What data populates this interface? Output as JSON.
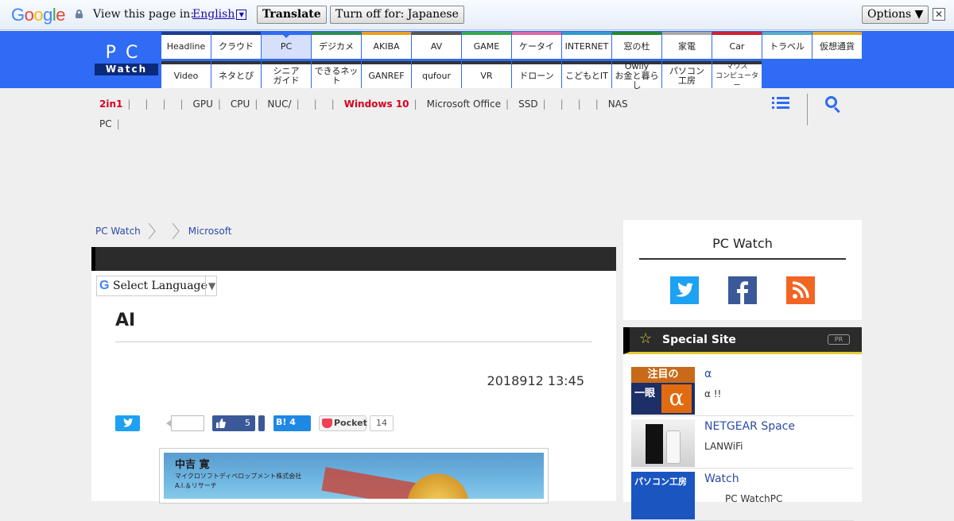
{
  "google_bar": {
    "logo_letters": [
      {
        "ch": "G",
        "color": "#4285f4"
      },
      {
        "ch": "o",
        "color": "#ea4335"
      },
      {
        "ch": "o",
        "color": "#fbbc05"
      },
      {
        "ch": "g",
        "color": "#4285f4"
      },
      {
        "ch": "l",
        "color": "#34a853"
      },
      {
        "ch": "e",
        "color": "#ea4335"
      }
    ],
    "prompt": "View this page in:",
    "language": "English",
    "translate_label": "Translate",
    "turn_off_label": "Turn off for: Japanese",
    "options_label": "Options ▼",
    "close_glyph": "✕"
  },
  "logo": {
    "top": "PC",
    "bottom": "Watch"
  },
  "nav": {
    "row1": [
      {
        "label": "Headline",
        "color": "#1c3c8c"
      },
      {
        "label": "クラウド",
        "color": "#1c3c8c"
      },
      {
        "label": "PC",
        "color": "#2f6bf4",
        "selected": true
      },
      {
        "label": "デジカメ",
        "color": "#2e8b57"
      },
      {
        "label": "AKIBA",
        "color": "#e8a020"
      },
      {
        "label": "AV",
        "color": "#555555"
      },
      {
        "label": "GAME",
        "color": "#33aa55"
      },
      {
        "label": "ケータイ",
        "color": "#dd66aa"
      },
      {
        "label": "INTERNET",
        "color": "#3399cc"
      },
      {
        "label": "窓の杜",
        "color": "#228833"
      },
      {
        "label": "家電",
        "color": "#aaaaaa"
      },
      {
        "label": "Car",
        "color": "#cc2233"
      },
      {
        "label": "トラベル",
        "color": "#55aacc"
      },
      {
        "label": "仮想通貨",
        "color": "#ddaa33"
      }
    ],
    "row2": [
      {
        "label": "Video",
        "color": "#333333"
      },
      {
        "label": "ネタとぴ",
        "color": "#333333"
      },
      {
        "label": "シニア\nガイド",
        "color": "#333333"
      },
      {
        "label": "できるネット",
        "color": "#333333"
      },
      {
        "label": "GANREF",
        "color": "#333333"
      },
      {
        "label": "qufour",
        "color": "#333333"
      },
      {
        "label": "VR",
        "color": "#333333"
      },
      {
        "label": "ドローン",
        "color": "#333333"
      },
      {
        "label": "こどもとIT",
        "color": "#333333"
      },
      {
        "label": "Owlly\nお金と暮らし",
        "color": "#333333"
      },
      {
        "label": "パソコン\n工房",
        "color": "#333333"
      },
      {
        "label": "マウス\nコンピューター",
        "color": "#333333",
        "small": true
      }
    ]
  },
  "subnav": {
    "line1": [
      {
        "label": "2in1",
        "red": true
      },
      {
        "label": ""
      },
      {
        "label": ""
      },
      {
        "label": ""
      },
      {
        "label": "GPU"
      },
      {
        "label": "CPU"
      },
      {
        "label": "NUC/"
      },
      {
        "label": ""
      },
      {
        "label": ""
      },
      {
        "label": "Windows 10",
        "red": true
      },
      {
        "label": "Microsoft Office"
      },
      {
        "label": "SSD"
      },
      {
        "label": ""
      },
      {
        "label": ""
      },
      {
        "label": ""
      },
      {
        "label": "NAS",
        "last": true
      }
    ],
    "line2": [
      {
        "label": "PC"
      }
    ]
  },
  "breadcrumb": {
    "home": "PC Watch",
    "current": "Microsoft"
  },
  "article": {
    "select_language": "Select Language",
    "title": "AI",
    "date": "2018912 13:45",
    "fb_count": "5",
    "hatena_label": "B! 4",
    "pocket_label": "Pocket",
    "pocket_count": "14",
    "photo_name": "中吉 寛",
    "photo_company": "マイクロソフトディベロップメント株式会社",
    "photo_sub": "A.I.＆リサーチ"
  },
  "sidebar": {
    "social_title": "PC Watch",
    "special_title": "Special Site",
    "pr_label": "PR",
    "items": [
      {
        "title": "α",
        "desc": "α !!",
        "thumb_text": "注目の\n一眼\nα"
      },
      {
        "title": "NETGEAR Space",
        "desc": "LANWiFi",
        "thumb_text": ""
      },
      {
        "title": "Watch",
        "desc": "PC WatchPC",
        "thumb_text": "パソコン工房"
      }
    ]
  }
}
